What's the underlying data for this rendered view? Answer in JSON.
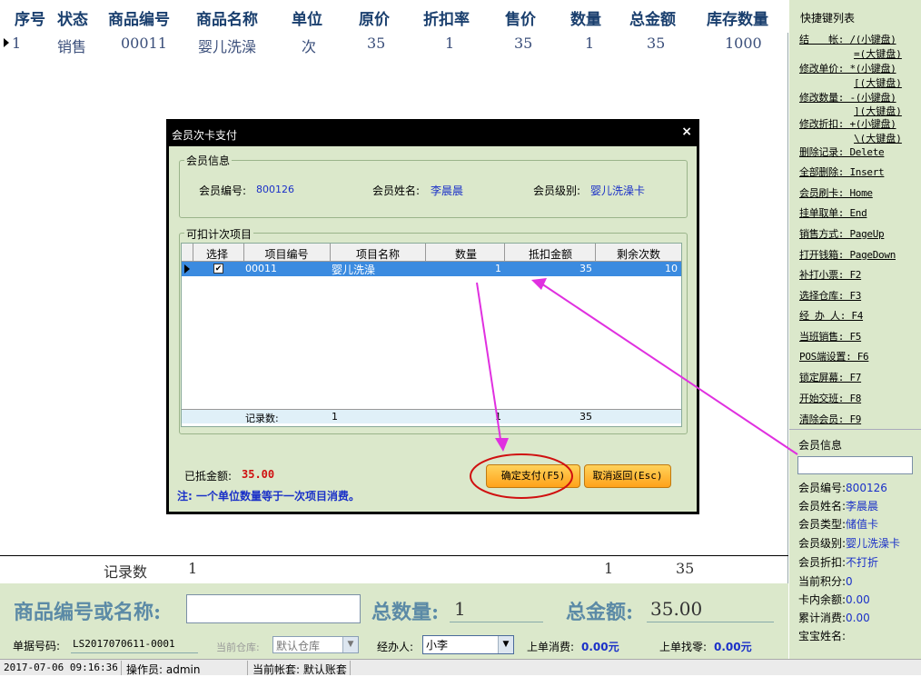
{
  "header": [
    "序号",
    "状态",
    "商品编号",
    "商品名称",
    "单位",
    "原价",
    "折扣率",
    "售价",
    "数量",
    "总金额",
    "库存数量"
  ],
  "row": {
    "no": "1",
    "status": "销售",
    "code": "00011",
    "name": "婴儿洗澡",
    "unit": "次",
    "orig": "35",
    "disc": "1",
    "price": "35",
    "qty": "1",
    "total": "35",
    "stock": "1000"
  },
  "record_count": {
    "label": "记录数",
    "count": "1",
    "qty": "1",
    "total": "35"
  },
  "bottom": {
    "search_label": "商品编号或名称:",
    "search_value": "",
    "qty_label": "总数量:",
    "qty_value": "1",
    "amount_label": "总金额:",
    "amount_value": "35.00",
    "doc_label": "单据号码:",
    "doc_value": "LS2017070611-0001",
    "wh_label": "当前仓库:",
    "wh_value": "默认仓库",
    "op_label": "经办人:",
    "op_value": "小李",
    "last_consume_label": "上单消费:",
    "last_consume_value": "0.00元",
    "last_change_label": "上单找零:",
    "last_change_value": "0.00元"
  },
  "status": {
    "datetime": "2017-07-06 09:16:36",
    "operator": "操作员: admin",
    "account": "当前帐套: 默认账套"
  },
  "shortcuts": {
    "title": "快捷键列表",
    "items": [
      {
        "a": "结　　帐: /(小键盘)",
        "b": "=(大键盘)"
      },
      {
        "a": "修改单价: *(小键盘)",
        "b": "[(大键盘)"
      },
      {
        "a": "修改数量: -(小键盘)",
        "b": "](大键盘)"
      },
      {
        "a": "修改折扣: +(小键盘)",
        "b": "\\(大键盘)"
      },
      {
        "a": "删除记录: Delete"
      },
      {
        "a": "全部删除: Insert"
      },
      {
        "a": "会员刷卡: Home"
      },
      {
        "a": "挂单取单: End"
      },
      {
        "a": "销售方式: PageUp"
      },
      {
        "a": "打开钱箱: PageDown"
      },
      {
        "a": "补打小票: F2"
      },
      {
        "a": "选择仓库: F3"
      },
      {
        "a": "经 办 人: F4"
      },
      {
        "a": "当班销售: F5"
      },
      {
        "a": "POS端设置: F6"
      },
      {
        "a": "锁定屏幕: F7"
      },
      {
        "a": "开始交班: F8"
      },
      {
        "a": "清除会员: F9"
      }
    ]
  },
  "member_panel": {
    "title": "会员信息",
    "input": "",
    "fields": [
      {
        "k": "会员编号:",
        "v": "800126"
      },
      {
        "k": "会员姓名:",
        "v": "李晨晨"
      },
      {
        "k": "会员类型:",
        "v": "储值卡"
      },
      {
        "k": "会员级别:",
        "v": "婴儿洗澡卡"
      },
      {
        "k": "会员折扣:",
        "v": "不打折"
      },
      {
        "k": "当前积分:",
        "v": "0"
      },
      {
        "k": "卡内余额:",
        "v": "0.00"
      },
      {
        "k": "累计消费:",
        "v": "0.00"
      },
      {
        "k": "宝宝姓名:",
        "v": ""
      }
    ]
  },
  "dialog": {
    "title": "会员次卡支付",
    "close": "×",
    "member_group": "会员信息",
    "member_no_label": "会员编号:",
    "member_no": "800126",
    "member_name_label": "会员姓名:",
    "member_name": "李晨晨",
    "member_level_label": "会员级别:",
    "member_level": "婴儿洗澡卡",
    "items_group": "可扣计次项目",
    "cols": [
      "选择",
      "项目编号",
      "项目名称",
      "数量",
      "抵扣金额",
      "剩余次数"
    ],
    "item": {
      "checked": "✔",
      "code": "00011",
      "name": "婴儿洗澡",
      "qty": "1",
      "amount": "35",
      "remain": "10"
    },
    "footer": {
      "label": "记录数:",
      "count": "1",
      "qty": "1",
      "amount": "35"
    },
    "deducted_label": "已抵金额:",
    "deducted_value": "35.00",
    "note": "注: 一个单位数量等于一次项目消费。",
    "confirm": "确定支付(F5)",
    "cancel": "取消返回(Esc)"
  },
  "colors": {
    "panel": "#dbe8cb",
    "accent_red": "#d01010",
    "arrow": "#e030e0",
    "link_blue": "#1a30c8"
  }
}
